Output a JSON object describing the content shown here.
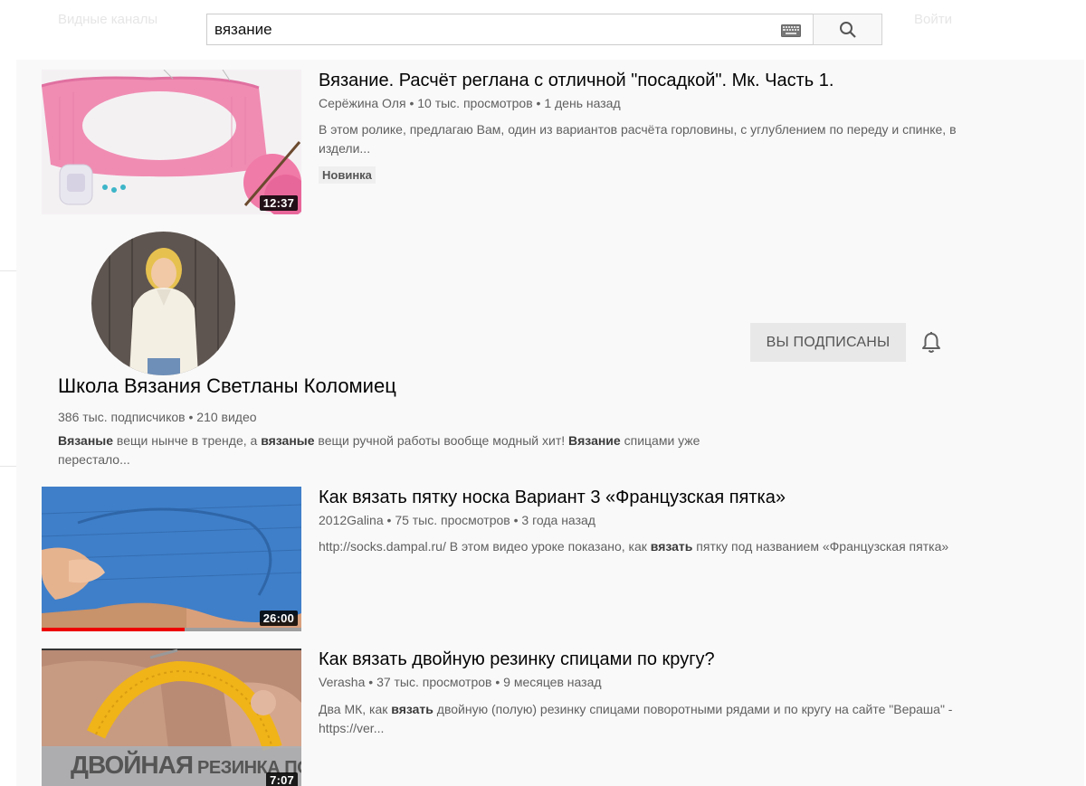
{
  "masthead": {
    "left_text": "Видные каналы",
    "right_text": "Войти"
  },
  "search": {
    "query": "вязание",
    "keyboard_icon": "keyboard-icon",
    "search_icon": "search-icon"
  },
  "results": [
    {
      "title": "Вязание. Расчёт реглана с отличной \"посадкой\". Мк. Часть 1.",
      "channel": "Серёжина Оля",
      "views": "10 тыс. просмотров",
      "age": "1 день назад",
      "description": "В этом ролике, предлагаю Вам, один из вариантов расчёта горловины, с углублением по переду и спинке, в издели...",
      "badge": "Новинка",
      "duration": "12:37"
    },
    {
      "title": "Как вязать пятку носка Вариант 3 «Французская пятка»",
      "channel": "2012Galina",
      "views": "75 тыс. просмотров",
      "age": "3 года назад",
      "description_pre": "http://socks.dampal.ru/ В этом видео уроке показано, как ",
      "description_bold": "вязать",
      "description_post": " пятку под названием «Французская пятка»",
      "duration": "26:00",
      "watched_progress": 0.55
    },
    {
      "title": "Как вязать двойную резинку спицами по кругу?",
      "channel": "Verasha",
      "views": "37 тыс. просмотров",
      "age": "9 месяцев назад",
      "description_pre": "Два МК, как ",
      "description_bold": "вязать",
      "description_post": " двойную (полую) резинку спицами поворотными рядами и по кругу на сайте \"Вераша\" - https://ver...",
      "duration": "7:07",
      "thumb_caption_a": "ДВОЙНАЯ",
      "thumb_caption_b": " РЕЗИНКА ПО КРУГУ"
    }
  ],
  "channel": {
    "name": "Школа Вязания Светланы Коломиец",
    "subscribers": "386 тыс. подписчиков",
    "videos": "210 видео",
    "desc_1": "Вязаные",
    "desc_2": " вещи нынче в тренде, а ",
    "desc_3": "вязаные",
    "desc_4": " вещи ручной работы вообще модный хит! ",
    "desc_5": "Вязание",
    "desc_6": " спицами уже перестало...",
    "subscribed_label": "ВЫ ПОДПИСАНЫ",
    "bell_icon": "bell-icon"
  },
  "meta_separator": "•"
}
